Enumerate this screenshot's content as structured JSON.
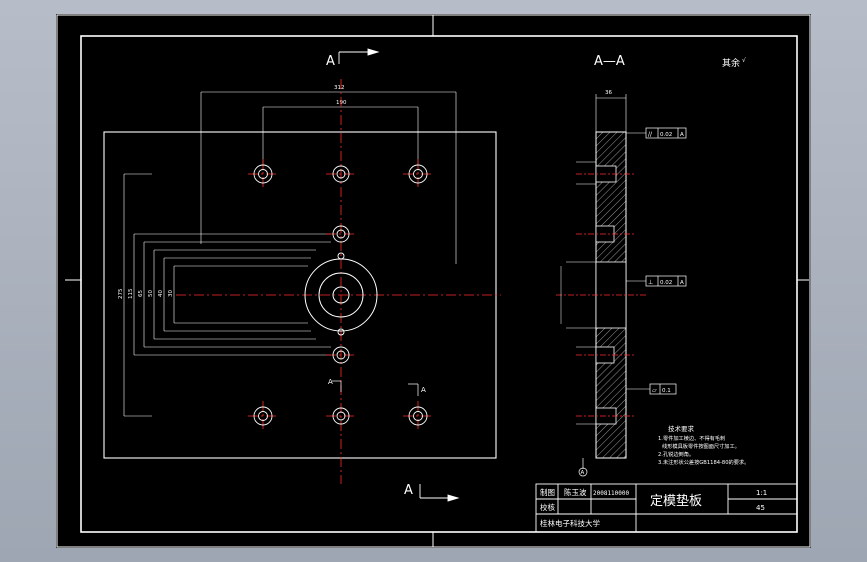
{
  "drawing": {
    "title": "定模垫板",
    "scale": "1:1",
    "material": "45",
    "role_draw": "制图",
    "role_check": "校核",
    "drafter_name": "陈玉波",
    "drawing_number": "2008110000",
    "school": "桂林电子科技大学",
    "section_label": "A",
    "section_title": "A—A",
    "roughness_note": "其余"
  },
  "dimensions": {
    "top_width": "312",
    "top_inner": "190",
    "left_height": "275",
    "left_1": "115",
    "left_2": "65",
    "left_3": "50",
    "left_4": "40",
    "left_5": "30",
    "side_thickness": "36"
  },
  "tolerances": {
    "parallel": "//",
    "parallel_value": "0.02",
    "parallel_ref": "A",
    "perp_value": "0.02",
    "perp_ref": "A",
    "datum": "A",
    "flat_value": "0.1"
  },
  "tech_notes": {
    "heading": "技术要求",
    "items": [
      "1.零件加工棱边、不得有毛刺",
      "线形模具板零件按图面尺寸加工。",
      "2.孔锐边倒角。",
      "3.未注形状公差按GB1184-80的要求。"
    ]
  },
  "colors": {
    "sheet": "#000000",
    "line": "#ffffff",
    "centerline": "#ff2a2a",
    "hatch": "#ffffff"
  }
}
